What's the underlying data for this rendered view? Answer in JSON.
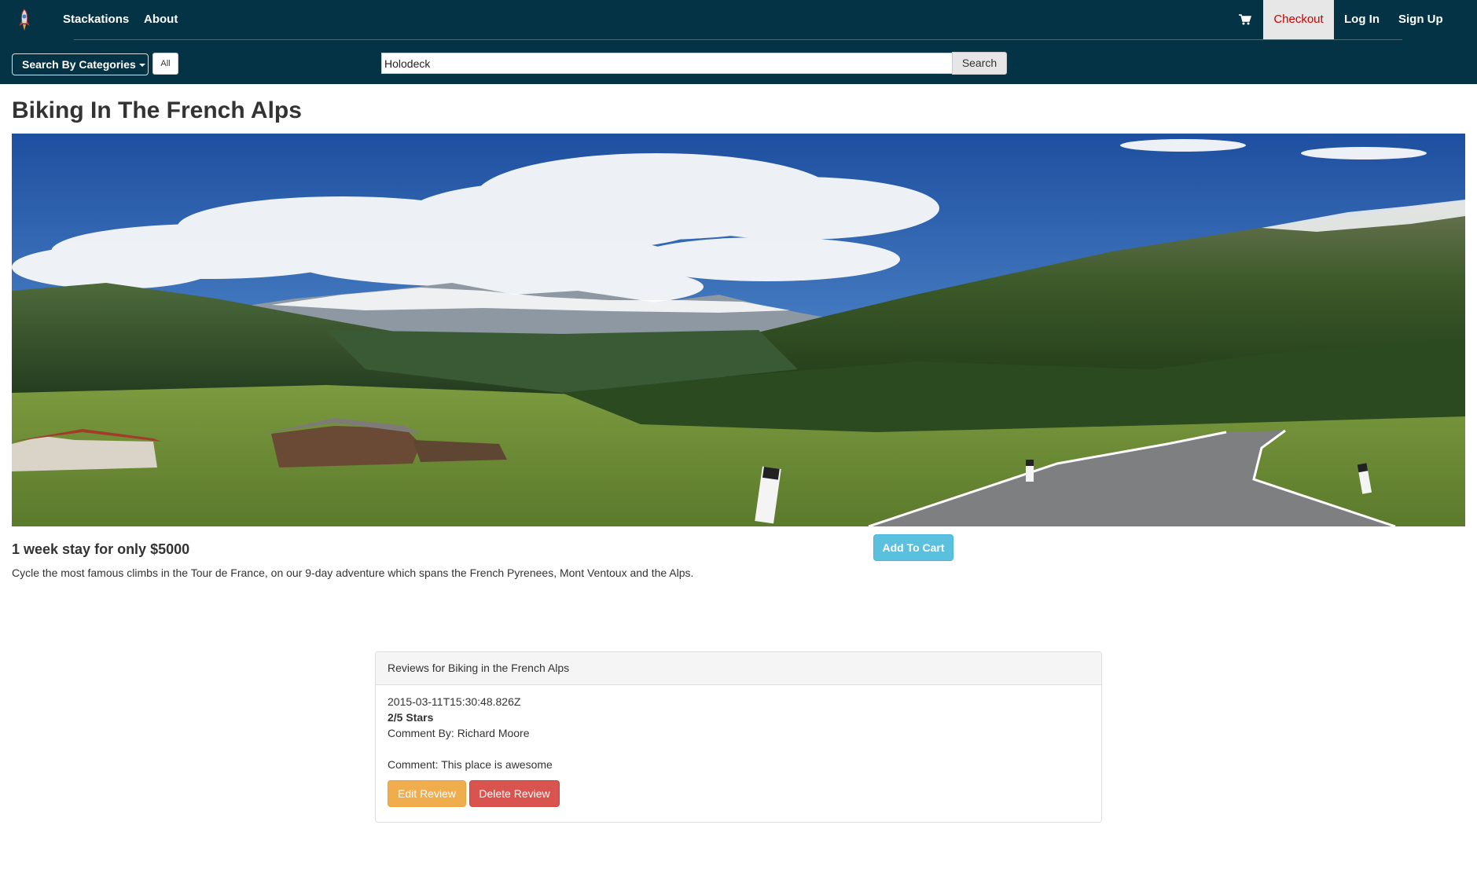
{
  "navbar": {
    "brand": "Stackations",
    "about": "About",
    "checkout": "Checkout",
    "login": "Log In",
    "signup": "Sign Up",
    "cart_icon": "shopping-cart-icon",
    "logo_icon": "rocket-icon"
  },
  "search": {
    "categories_label": "Search By Categories",
    "all_label": "All",
    "query": "Holodeck",
    "button_label": "Search"
  },
  "product": {
    "title": "Biking In The French Alps",
    "price_text": "1 week stay for only $5000",
    "add_to_cart": "Add To Cart",
    "description": "Cycle the most famous climbs in the Tour de France, on our 9-day adventure which spans the French Pyrenees, Mont Ventoux and the Alps."
  },
  "reviews": {
    "heading": "Reviews for Biking in the French Alps",
    "items": [
      {
        "date": "2015-03-11T15:30:48.826Z",
        "stars": "2/5 Stars",
        "author": "Comment By: Richard Moore",
        "comment": "Comment: This place is awesome",
        "edit_label": "Edit Review",
        "delete_label": "Delete Review"
      }
    ]
  },
  "colors": {
    "navbar_bg": "#033344",
    "checkout_text": "#cc0000",
    "info_button": "#5bc0de",
    "warning_button": "#f0ad4e",
    "danger_button": "#d9534f"
  }
}
